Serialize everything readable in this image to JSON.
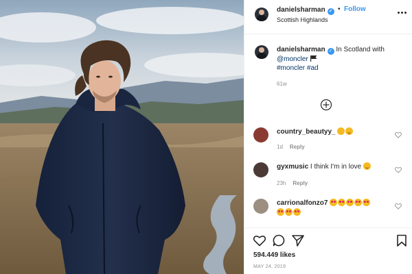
{
  "header": {
    "username": "danielsharman",
    "separator": "•",
    "follow_label": "Follow",
    "location": "Scottish Highlands",
    "avatar_icon": "avatar-icon",
    "more_icon": "more-options-icon"
  },
  "caption": {
    "username": "danielsharman",
    "text_before": "In Scotland with",
    "mention": "@moncler",
    "hashtags": "#moncler #ad",
    "time": "61w",
    "flag_icon": "black-flag-icon"
  },
  "load_more_icon": "plus-circle-icon",
  "comments": [
    {
      "username": "country_beautyy_",
      "text": "",
      "emojis": [
        "star-struck",
        "smile"
      ],
      "time": "1d",
      "reply_label": "Reply"
    },
    {
      "username": "gyxmusic",
      "text": "I think I'm in love",
      "emojis": [
        "smile"
      ],
      "time": "23h",
      "reply_label": "Reply"
    },
    {
      "username": "carrionalfonzo7",
      "text": "",
      "emojis": [
        "heart-eyes",
        "heart-eyes",
        "heart-eyes",
        "heart-eyes",
        "heart-eyes",
        "heart-eyes",
        "heart-eyes",
        "heart-eyes"
      ],
      "time": "",
      "reply_label": ""
    }
  ],
  "actions": {
    "like_icon": "heart-icon",
    "comment_icon": "comment-icon",
    "share_icon": "paper-plane-icon",
    "save_icon": "bookmark-icon",
    "likes": "594.449 likes",
    "date": "MAY 24, 2019"
  },
  "colors": {
    "link_blue": "#3897f0",
    "mention_blue": "#003569",
    "secondary_text": "#8e8e8e",
    "border": "#efefef"
  }
}
